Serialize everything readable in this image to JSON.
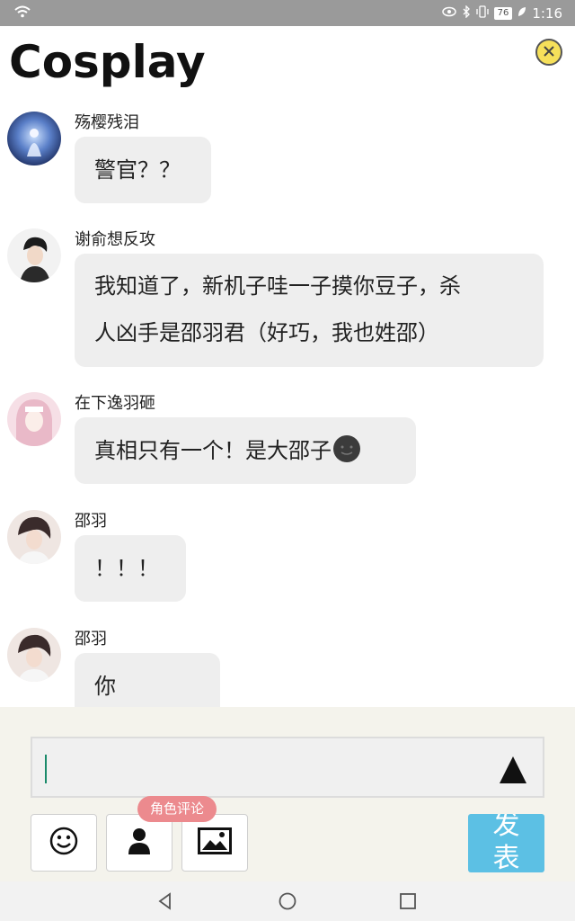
{
  "status_bar": {
    "battery": "76",
    "time": "1:16"
  },
  "header": {
    "title": "Cosplay"
  },
  "messages": [
    {
      "name": "殇樱残泪",
      "text_lines": [
        "警官？？"
      ]
    },
    {
      "name": "谢俞想反攻",
      "text_lines": [
        "我知道了，新机子哇一子摸你豆子，杀",
        "人凶手是邵羽君（好巧，我也姓邵）"
      ]
    },
    {
      "name": "在下逸羽砸",
      "text_lines": [
        "真相只有一个！是大邵子"
      ]
    },
    {
      "name": "邵羽",
      "text_lines": [
        "！！！"
      ]
    },
    {
      "name": "邵羽",
      "text_lines": [
        "你们……？"
      ]
    }
  ],
  "composer": {
    "value": "",
    "role_tag": "角色评论",
    "publish_label": "发表"
  },
  "icons": {
    "close": "close-icon",
    "emoji": "smiley-icon",
    "role": "person-icon",
    "image": "image-icon",
    "send": "triangle-up-icon"
  },
  "colors": {
    "accent_blue": "#5cc0e4",
    "tag_pink": "#ec8a8e",
    "close_yellow": "#f6e05a",
    "bubble_gray": "#eeeeee"
  }
}
